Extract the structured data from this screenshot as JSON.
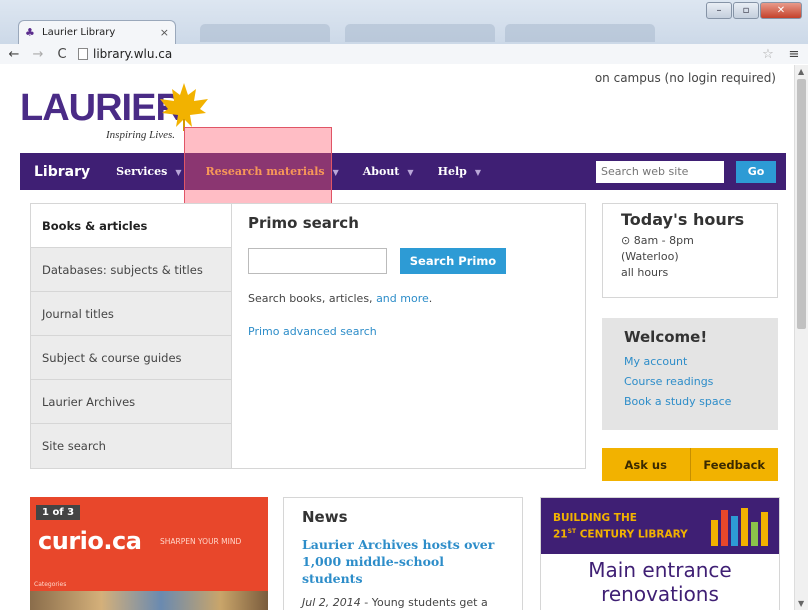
{
  "browser": {
    "tab_title": "Laurier Library",
    "tab_close": "×",
    "url": "library.wlu.ca"
  },
  "header": {
    "campus_note": "on campus (no login required)",
    "logo_text": "LAURIER",
    "logo_tagline": "Inspiring Lives."
  },
  "topnav": {
    "brand": "Library",
    "items": [
      {
        "label": "Services"
      },
      {
        "label": "Research materials"
      },
      {
        "label": "About"
      },
      {
        "label": "Help"
      }
    ],
    "search_placeholder": "Search web site",
    "go_label": "Go"
  },
  "sidetabs": [
    "Books & articles",
    "Databases: subjects & titles",
    "Journal titles",
    "Subject & course guides",
    "Laurier Archives",
    "Site search"
  ],
  "primo": {
    "title": "Primo search",
    "button": "Search Primo",
    "desc_prefix": "Search books, articles, ",
    "desc_link": "and more",
    "desc_suffix": ".",
    "advanced": "Primo advanced search"
  },
  "hours": {
    "title": "Today's hours",
    "time": "⊙ 8am - 8pm",
    "location": "(Waterloo)",
    "all_hours": "all hours"
  },
  "welcome": {
    "title": "Welcome!",
    "links": [
      "My account",
      "Course readings",
      "Book a study space"
    ]
  },
  "ask": {
    "ask_us": "Ask us",
    "feedback": "Feedback"
  },
  "curio": {
    "counter": "1 of 3",
    "logo": "curio.ca",
    "tagline": "SHARPEN YOUR MIND",
    "categories": "Categories"
  },
  "news": {
    "title": "News",
    "headline": "Laurier Archives hosts over 1,000 middle-school students",
    "date": "Jul 2, 2014",
    "body": " - Young students get a taste of primary-source research as"
  },
  "building": {
    "line1": "BUILDING THE",
    "line2_num": "21",
    "line2_sup": "ST",
    "line2_rest": " CENTURY LIBRARY",
    "main_title": "Main entrance renovations"
  },
  "colors": {
    "brand_purple": "#3f1f74",
    "accent_blue": "#2d9bd5",
    "ask_gold": "#f2b200",
    "curio_red": "#e8472b"
  }
}
